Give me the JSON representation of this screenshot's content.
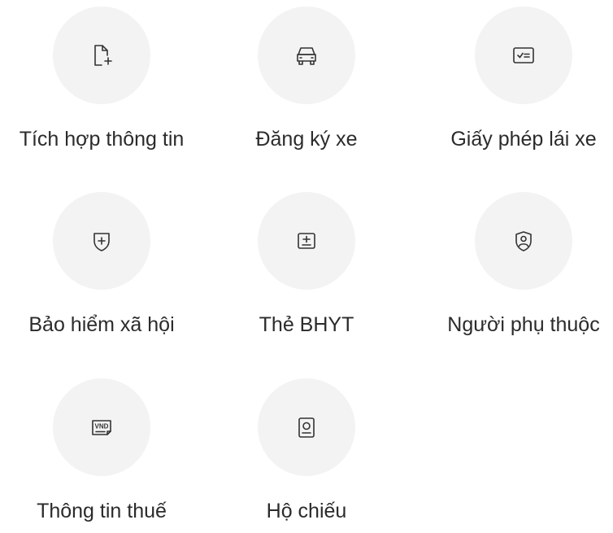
{
  "menu": {
    "items": [
      {
        "label": "Tích hợp thông tin",
        "icon": "document-add-icon"
      },
      {
        "label": "Đăng ký xe",
        "icon": "car-icon"
      },
      {
        "label": "Giấy phép lái xe",
        "icon": "license-card-icon"
      },
      {
        "label": "Bảo hiểm xã hội",
        "icon": "shield-plus-icon"
      },
      {
        "label": "Thẻ BHYT",
        "icon": "health-card-icon"
      },
      {
        "label": "Người phụ thuộc",
        "icon": "person-shield-icon"
      },
      {
        "label": "Thông tin thuế",
        "icon": "tax-vnd-icon",
        "icon_text": "VND"
      },
      {
        "label": "Hộ chiếu",
        "icon": "passport-icon"
      }
    ]
  },
  "colors": {
    "circle_bg": "#f3f3f3",
    "icon_stroke": "#333333",
    "text": "#2b2b2b"
  }
}
